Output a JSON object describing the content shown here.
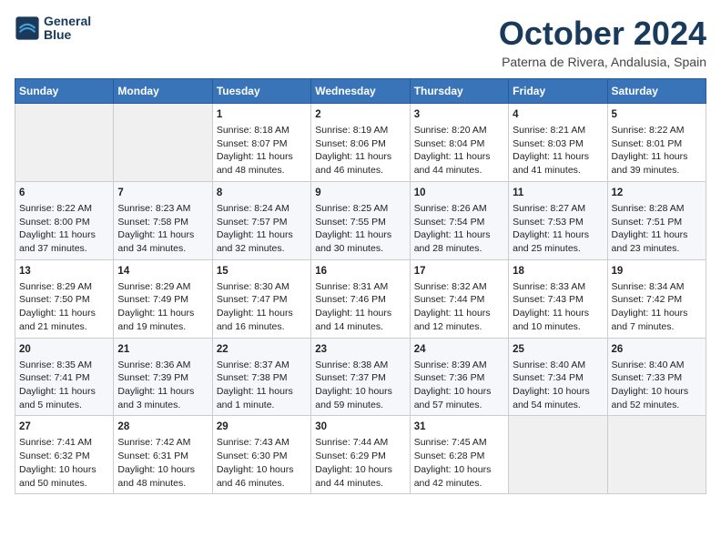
{
  "header": {
    "logo_line1": "General",
    "logo_line2": "Blue",
    "month": "October 2024",
    "location": "Paterna de Rivera, Andalusia, Spain"
  },
  "weekdays": [
    "Sunday",
    "Monday",
    "Tuesday",
    "Wednesday",
    "Thursday",
    "Friday",
    "Saturday"
  ],
  "weeks": [
    [
      {
        "day": "",
        "text": ""
      },
      {
        "day": "",
        "text": ""
      },
      {
        "day": "1",
        "text": "Sunrise: 8:18 AM\nSunset: 8:07 PM\nDaylight: 11 hours and 48 minutes."
      },
      {
        "day": "2",
        "text": "Sunrise: 8:19 AM\nSunset: 8:06 PM\nDaylight: 11 hours and 46 minutes."
      },
      {
        "day": "3",
        "text": "Sunrise: 8:20 AM\nSunset: 8:04 PM\nDaylight: 11 hours and 44 minutes."
      },
      {
        "day": "4",
        "text": "Sunrise: 8:21 AM\nSunset: 8:03 PM\nDaylight: 11 hours and 41 minutes."
      },
      {
        "day": "5",
        "text": "Sunrise: 8:22 AM\nSunset: 8:01 PM\nDaylight: 11 hours and 39 minutes."
      }
    ],
    [
      {
        "day": "6",
        "text": "Sunrise: 8:22 AM\nSunset: 8:00 PM\nDaylight: 11 hours and 37 minutes."
      },
      {
        "day": "7",
        "text": "Sunrise: 8:23 AM\nSunset: 7:58 PM\nDaylight: 11 hours and 34 minutes."
      },
      {
        "day": "8",
        "text": "Sunrise: 8:24 AM\nSunset: 7:57 PM\nDaylight: 11 hours and 32 minutes."
      },
      {
        "day": "9",
        "text": "Sunrise: 8:25 AM\nSunset: 7:55 PM\nDaylight: 11 hours and 30 minutes."
      },
      {
        "day": "10",
        "text": "Sunrise: 8:26 AM\nSunset: 7:54 PM\nDaylight: 11 hours and 28 minutes."
      },
      {
        "day": "11",
        "text": "Sunrise: 8:27 AM\nSunset: 7:53 PM\nDaylight: 11 hours and 25 minutes."
      },
      {
        "day": "12",
        "text": "Sunrise: 8:28 AM\nSunset: 7:51 PM\nDaylight: 11 hours and 23 minutes."
      }
    ],
    [
      {
        "day": "13",
        "text": "Sunrise: 8:29 AM\nSunset: 7:50 PM\nDaylight: 11 hours and 21 minutes."
      },
      {
        "day": "14",
        "text": "Sunrise: 8:29 AM\nSunset: 7:49 PM\nDaylight: 11 hours and 19 minutes."
      },
      {
        "day": "15",
        "text": "Sunrise: 8:30 AM\nSunset: 7:47 PM\nDaylight: 11 hours and 16 minutes."
      },
      {
        "day": "16",
        "text": "Sunrise: 8:31 AM\nSunset: 7:46 PM\nDaylight: 11 hours and 14 minutes."
      },
      {
        "day": "17",
        "text": "Sunrise: 8:32 AM\nSunset: 7:44 PM\nDaylight: 11 hours and 12 minutes."
      },
      {
        "day": "18",
        "text": "Sunrise: 8:33 AM\nSunset: 7:43 PM\nDaylight: 11 hours and 10 minutes."
      },
      {
        "day": "19",
        "text": "Sunrise: 8:34 AM\nSunset: 7:42 PM\nDaylight: 11 hours and 7 minutes."
      }
    ],
    [
      {
        "day": "20",
        "text": "Sunrise: 8:35 AM\nSunset: 7:41 PM\nDaylight: 11 hours and 5 minutes."
      },
      {
        "day": "21",
        "text": "Sunrise: 8:36 AM\nSunset: 7:39 PM\nDaylight: 11 hours and 3 minutes."
      },
      {
        "day": "22",
        "text": "Sunrise: 8:37 AM\nSunset: 7:38 PM\nDaylight: 11 hours and 1 minute."
      },
      {
        "day": "23",
        "text": "Sunrise: 8:38 AM\nSunset: 7:37 PM\nDaylight: 10 hours and 59 minutes."
      },
      {
        "day": "24",
        "text": "Sunrise: 8:39 AM\nSunset: 7:36 PM\nDaylight: 10 hours and 57 minutes."
      },
      {
        "day": "25",
        "text": "Sunrise: 8:40 AM\nSunset: 7:34 PM\nDaylight: 10 hours and 54 minutes."
      },
      {
        "day": "26",
        "text": "Sunrise: 8:40 AM\nSunset: 7:33 PM\nDaylight: 10 hours and 52 minutes."
      }
    ],
    [
      {
        "day": "27",
        "text": "Sunrise: 7:41 AM\nSunset: 6:32 PM\nDaylight: 10 hours and 50 minutes."
      },
      {
        "day": "28",
        "text": "Sunrise: 7:42 AM\nSunset: 6:31 PM\nDaylight: 10 hours and 48 minutes."
      },
      {
        "day": "29",
        "text": "Sunrise: 7:43 AM\nSunset: 6:30 PM\nDaylight: 10 hours and 46 minutes."
      },
      {
        "day": "30",
        "text": "Sunrise: 7:44 AM\nSunset: 6:29 PM\nDaylight: 10 hours and 44 minutes."
      },
      {
        "day": "31",
        "text": "Sunrise: 7:45 AM\nSunset: 6:28 PM\nDaylight: 10 hours and 42 minutes."
      },
      {
        "day": "",
        "text": ""
      },
      {
        "day": "",
        "text": ""
      }
    ]
  ]
}
